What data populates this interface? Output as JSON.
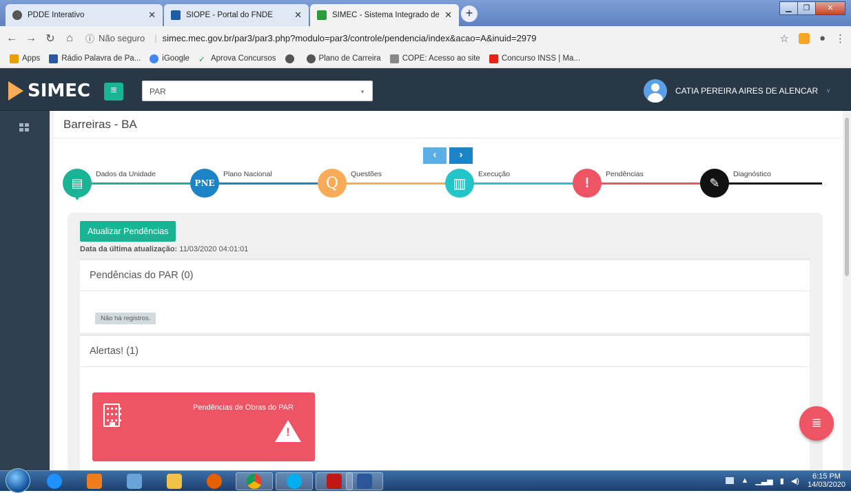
{
  "browser": {
    "tabs": [
      {
        "title": "PDDE Interativo",
        "active": false
      },
      {
        "title": "SIOPE - Portal do FNDE",
        "active": false
      },
      {
        "title": "SIMEC - Sistema Integrado de M",
        "active": true
      }
    ],
    "address": {
      "security": "Não seguro",
      "url": "simec.mec.gov.br/par3/par3.php?modulo=par3/controle/pendencia/index&acao=A&inuid=2979"
    },
    "bookmarks": [
      {
        "label": "Apps",
        "color": "#e8a000"
      },
      {
        "label": "Rádio Palavra de Pa...",
        "color": "#2b55a5"
      },
      {
        "label": "iGoogle",
        "color": "#4285f4"
      },
      {
        "label": "Aprova Concursos",
        "color": "#2a9d3a"
      },
      {
        "label": "",
        "color": "#555555"
      },
      {
        "label": "Plano de Carreira",
        "color": "#555555"
      },
      {
        "label": "COPE: Acesso ao site",
        "color": "#888888"
      },
      {
        "label": "Concurso INSS | Ma...",
        "color": "#e62117"
      }
    ]
  },
  "header": {
    "logo": "SIMEC",
    "module": "PAR",
    "user": "CATIA PEREIRA AIRES DE ALENCAR"
  },
  "page": {
    "municipio": "Barreiras - BA",
    "steps": [
      {
        "label": "Dados da Unidade",
        "icon": "document-icon",
        "glyph": "▤",
        "color": "#1ab394"
      },
      {
        "label": "Plano Nacional",
        "icon": "pne-icon",
        "glyph": "PNE",
        "color": "#1c84c6"
      },
      {
        "label": "Questões",
        "icon": "q-icon",
        "glyph": "Q",
        "color": "#f8ac59"
      },
      {
        "label": "Execução",
        "icon": "bar-chart-icon",
        "glyph": "▥",
        "color": "#23c6c8"
      },
      {
        "label": "Pendências",
        "icon": "warning-icon",
        "glyph": "!",
        "color": "#ed5565"
      },
      {
        "label": "Diagnóstico",
        "icon": "edit-icon",
        "glyph": "✎",
        "color": "#111111"
      }
    ],
    "update_button": "Atualizar Pendências",
    "last_update_label": "Data da última atualização:",
    "last_update_value": "11/03/2020 04:01:01",
    "pendencias_title": "Pendências do PAR (0)",
    "no_records": "Não há registros.",
    "alertas_title": "Alertas! (1)",
    "alert_card_title": "Pendências de Obras do PAR"
  },
  "taskbar": {
    "time": "6:15 PM",
    "date": "14/03/2020"
  }
}
